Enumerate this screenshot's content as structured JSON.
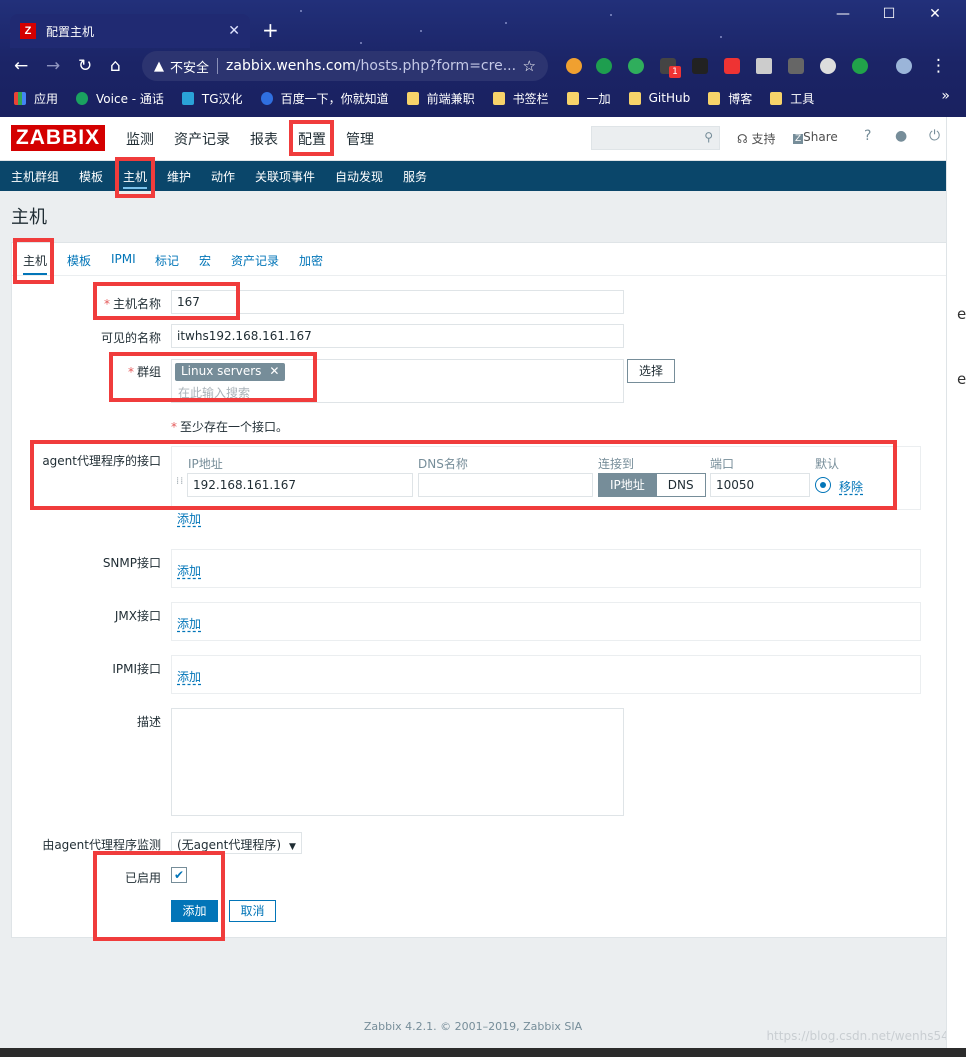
{
  "browser": {
    "tab_title": "配置主机",
    "tab_logo": "Z",
    "security_label": "不安全",
    "url_host": "zabbix.wenhs.com",
    "url_path": "/hosts.php?form=cre...",
    "ext_badge": "1",
    "bookmarks": [
      "应用",
      "Voice - 通话",
      "TG汉化",
      "百度一下，你就知道",
      "前端兼职",
      "书签栏",
      "一加",
      "GitHub",
      "博客",
      "工具"
    ]
  },
  "header": {
    "logo": "ZABBIX",
    "menu": [
      "监测",
      "资产记录",
      "报表",
      "配置",
      "管理"
    ],
    "support": "支持",
    "share": "Share",
    "help": "?"
  },
  "submenu": [
    "主机群组",
    "模板",
    "主机",
    "维护",
    "动作",
    "关联项事件",
    "自动发现",
    "服务"
  ],
  "page": {
    "title": "主机",
    "tabs": [
      "主机",
      "模板",
      "IPMI",
      "标记",
      "宏",
      "资产记录",
      "加密"
    ]
  },
  "form": {
    "host_name_label": "主机名称",
    "host_name_value": "167",
    "visible_name_label": "可见的名称",
    "visible_name_value": "itwhs192.168.161.167",
    "groups_label": "群组",
    "group_chip": "Linux servers",
    "group_chip_remove": "✕",
    "groups_placeholder": "在此输入搜索",
    "select_button": "选择",
    "required_star": "*",
    "interface_note": "至少存在一个接口。",
    "agent_iface_label": "agent代理程序的接口",
    "iface_headers": {
      "ip": "IP地址",
      "dns": "DNS名称",
      "connect": "连接到",
      "port": "端口",
      "default": "默认"
    },
    "agent_ip": "192.168.161.167",
    "agent_dns": "",
    "connect_ip": "IP地址",
    "connect_dns": "DNS",
    "agent_port": "10050",
    "remove_link": "移除",
    "add_link": "添加",
    "snmp_label": "SNMP接口",
    "jmx_label": "JMX接口",
    "ipmi_label": "IPMI接口",
    "description_label": "描述",
    "proxy_label": "由agent代理程序监测",
    "proxy_value": "(无agent代理程序)",
    "enabled_label": "已启用",
    "add_button": "添加",
    "cancel_button": "取消"
  },
  "footer": "Zabbix 4.2.1. © 2001–2019, Zabbix SIA",
  "watermark": "https://blog.csdn.net/wenhs5479",
  "right_strip_chars": [
    "e",
    "e"
  ],
  "colors": {
    "accent": "#0275b8",
    "brand": "#d40000",
    "nav": "#0a466a",
    "highlight": "#f03c3c"
  }
}
